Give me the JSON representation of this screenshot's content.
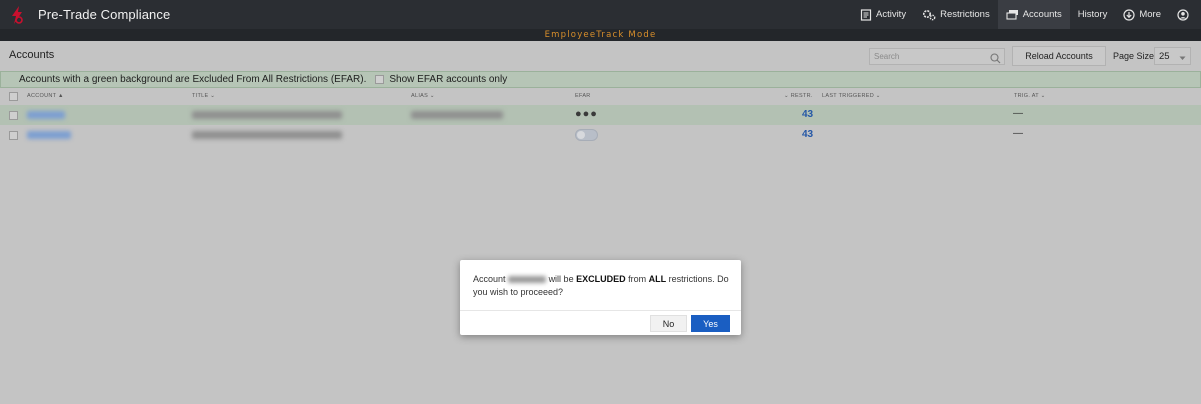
{
  "app": {
    "title": "Pre-Trade Compliance",
    "logo_icon": "brand-logo-icon",
    "brand_color": "#c8102e"
  },
  "nav": {
    "items": [
      {
        "label": "Activity",
        "icon": "activity-icon"
      },
      {
        "label": "Restrictions",
        "icon": "restrictions-icon"
      },
      {
        "label": "Accounts",
        "icon": "accounts-icon",
        "active": true
      },
      {
        "label": "History"
      },
      {
        "label": "More",
        "icon": "more-icon"
      }
    ],
    "user_icon": "user-icon"
  },
  "mode_banner": {
    "text": "EmployeeTrack Mode",
    "color": "#d98f2b"
  },
  "header": {
    "title": "Accounts",
    "search_placeholder": "Search",
    "reload_label": "Reload Accounts",
    "page_size_label": "Page Size",
    "page_size_value": "25"
  },
  "efar_banner": {
    "text": "Accounts with a green background are Excluded From All Restrictions (EFAR).",
    "checkbox_label": "Show EFAR accounts only",
    "color": "#b6c5b6"
  },
  "table": {
    "columns": [
      "ACCOUNT",
      "TITLE",
      "ALIAS",
      "EFAR",
      "RESTR.",
      "LAST TRIGGERED",
      "TRIG. AT"
    ],
    "rows": [
      {
        "restr": "43",
        "trig_at": "—",
        "efar": true
      },
      {
        "restr": "43",
        "trig_at": "—",
        "efar": false
      }
    ]
  },
  "dialog": {
    "msg_prefix": "Account",
    "msg_will_be": "will be",
    "msg_excluded": "EXCLUDED",
    "msg_from": "from",
    "msg_all": "ALL",
    "msg_suffix": "restrictions. Do you wish to proceeed?",
    "no_label": "No",
    "yes_label": "Yes",
    "yes_color": "#1a5ec2"
  }
}
